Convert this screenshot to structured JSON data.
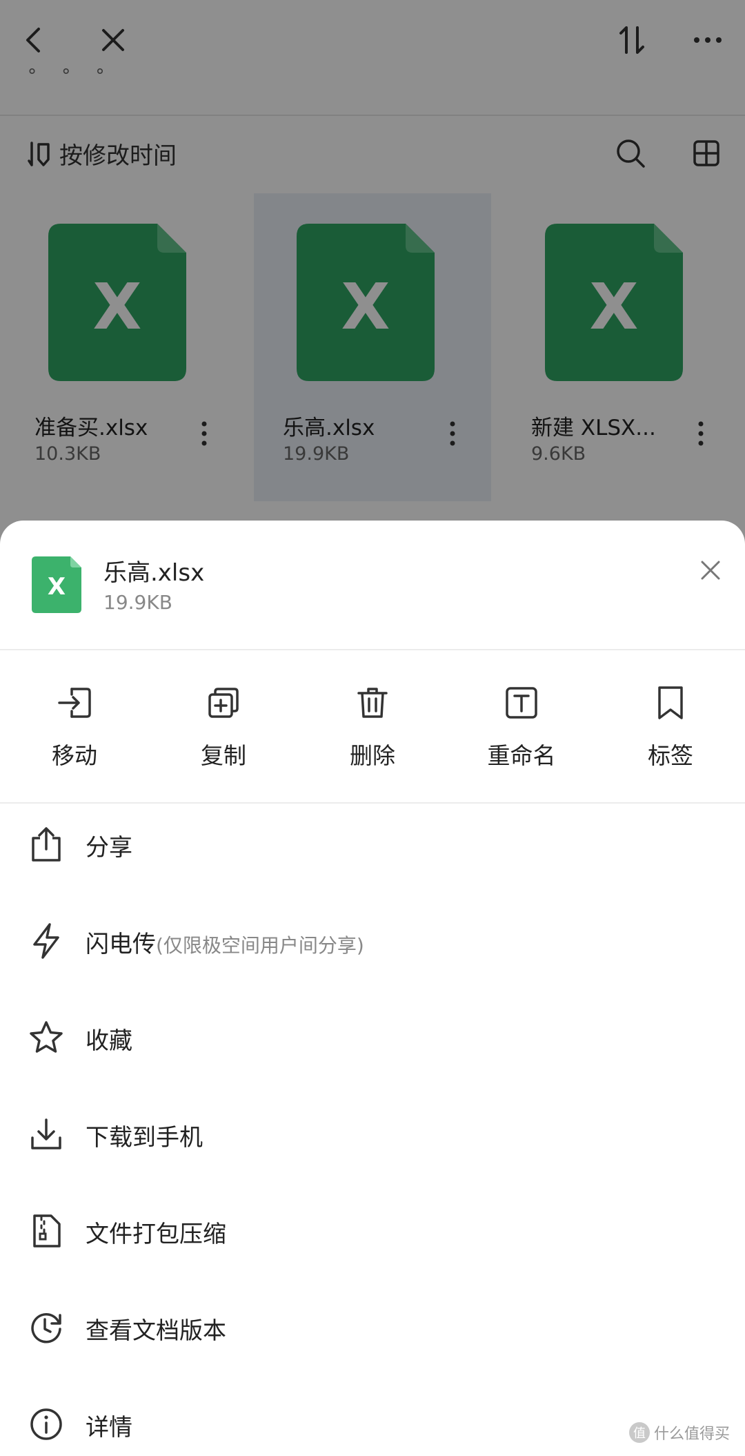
{
  "background": {
    "crumb": "° ° °",
    "sort_label": "按修改时间",
    "files": [
      {
        "name": "准备买.xlsx",
        "size": "10.3KB",
        "icon_letter": "X"
      },
      {
        "name": "乐高.xlsx",
        "size": "19.9KB",
        "icon_letter": "X"
      },
      {
        "name": "新建 XLSX...",
        "size": "9.6KB",
        "icon_letter": "X"
      }
    ]
  },
  "sheet": {
    "file": {
      "name": "乐高.xlsx",
      "size": "19.9KB",
      "icon_letter": "X"
    },
    "actions": [
      {
        "label": "移动",
        "icon": "move-icon"
      },
      {
        "label": "复制",
        "icon": "copy-icon"
      },
      {
        "label": "删除",
        "icon": "trash-icon"
      },
      {
        "label": "重命名",
        "icon": "rename-icon"
      },
      {
        "label": "标签",
        "icon": "bookmark-icon"
      }
    ],
    "menu": [
      {
        "label": "分享",
        "hint": "",
        "icon": "share-icon"
      },
      {
        "label": "闪电传",
        "hint": "(仅限极空间用户间分享)",
        "icon": "lightning-icon"
      },
      {
        "label": "收藏",
        "hint": "",
        "icon": "star-icon"
      },
      {
        "label": "下载到手机",
        "hint": "",
        "icon": "download-icon"
      },
      {
        "label": "文件打包压缩",
        "hint": "",
        "icon": "zip-file-icon"
      },
      {
        "label": "查看文档版本",
        "hint": "",
        "icon": "history-icon"
      },
      {
        "label": "详情",
        "hint": "",
        "icon": "info-icon"
      }
    ]
  },
  "watermark": {
    "badge": "值",
    "text": "什么值得买"
  },
  "colors": {
    "excel_dark": "#1f6b3a",
    "excel_light": "#2fa562",
    "scrim": "rgba(0,0,0,0.44)"
  }
}
